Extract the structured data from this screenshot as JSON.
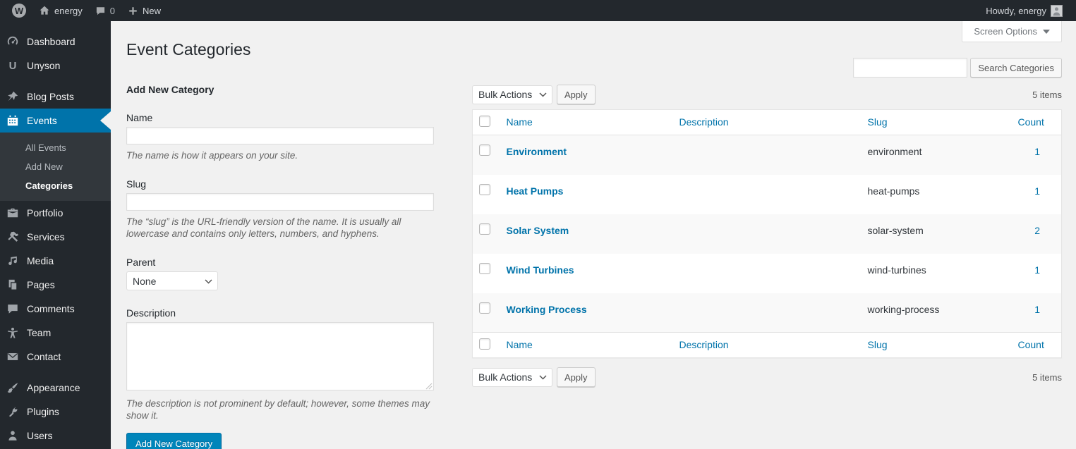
{
  "admin_bar": {
    "logo_letter": "W",
    "site_name": "energy",
    "comments_count": "0",
    "new_label": "New",
    "howdy_text": "Howdy, energy"
  },
  "sidebar": {
    "menu": [
      {
        "label": "Dashboard",
        "icon": "dashboard-icon"
      },
      {
        "label": "Unyson",
        "icon": "unyson-icon"
      },
      {
        "label": "Blog Posts",
        "icon": "pushpin-icon"
      },
      {
        "label": "Events",
        "icon": "calendar-icon",
        "active": true
      },
      {
        "label": "Portfolio",
        "icon": "portfolio-icon"
      },
      {
        "label": "Services",
        "icon": "hammer-icon"
      },
      {
        "label": "Media",
        "icon": "media-icon"
      },
      {
        "label": "Pages",
        "icon": "pages-icon"
      },
      {
        "label": "Comments",
        "icon": "comments-icon"
      },
      {
        "label": "Team",
        "icon": "team-icon"
      },
      {
        "label": "Contact",
        "icon": "email-icon"
      },
      {
        "label": "Appearance",
        "icon": "brush-icon"
      },
      {
        "label": "Plugins",
        "icon": "plugin-icon"
      },
      {
        "label": "Users",
        "icon": "users-icon"
      }
    ],
    "events_submenu": [
      {
        "label": "All Events"
      },
      {
        "label": "Add New"
      },
      {
        "label": "Categories",
        "current": true
      }
    ]
  },
  "page": {
    "title": "Event Categories",
    "screen_options_label": "Screen Options",
    "items_count": "5 items"
  },
  "search": {
    "input_value": "",
    "button_label": "Search Categories"
  },
  "form": {
    "heading": "Add New Category",
    "name_label": "Name",
    "name_help": "The name is how it appears on your site.",
    "slug_label": "Slug",
    "slug_help": "The “slug” is the URL-friendly version of the name. It is usually all lowercase and contains only letters, numbers, and hyphens.",
    "parent_label": "Parent",
    "parent_value": "None",
    "description_label": "Description",
    "description_help": "The description is not prominent by default; however, some themes may show it.",
    "submit_label": "Add New Category"
  },
  "table": {
    "bulk_actions_label": "Bulk Actions",
    "apply_label": "Apply",
    "columns": {
      "name": "Name",
      "description": "Description",
      "slug": "Slug",
      "count": "Count"
    },
    "rows": [
      {
        "name": "Environment",
        "description": "",
        "slug": "environment",
        "count": "1"
      },
      {
        "name": "Heat Pumps",
        "description": "",
        "slug": "heat-pumps",
        "count": "1"
      },
      {
        "name": "Solar System",
        "description": "",
        "slug": "solar-system",
        "count": "2"
      },
      {
        "name": "Wind Turbines",
        "description": "",
        "slug": "wind-turbines",
        "count": "1"
      },
      {
        "name": "Working Process",
        "description": "",
        "slug": "working-process",
        "count": "1"
      }
    ]
  },
  "colors": {
    "accent": "#0073aa",
    "primary_button": "#0085ba",
    "admin_bar_bg": "#23282d",
    "submenu_bg": "#32373c",
    "content_bg": "#f1f1f1",
    "link": "#0073aa",
    "row_alt": "#f9f9f9"
  }
}
